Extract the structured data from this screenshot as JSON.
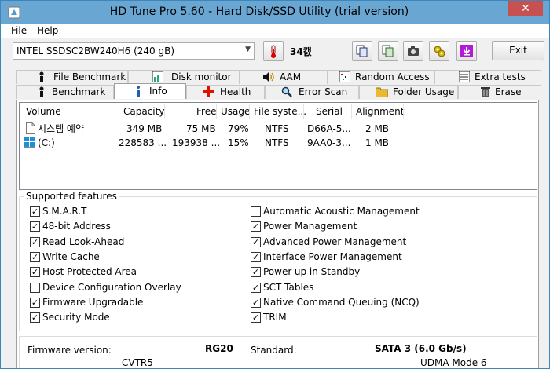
{
  "window": {
    "title": "HD Tune Pro 5.60 - Hard Disk/SSD Utility (trial version)",
    "close": "✕"
  },
  "menu": {
    "file": "File",
    "help": "Help"
  },
  "toolbar": {
    "drive": "INTEL SSDSC2BW240H6 (240 gB)",
    "temperature": "34캜",
    "exit": "Exit"
  },
  "tabs": {
    "row1": [
      "File Benchmark",
      "Disk monitor",
      "AAM",
      "Random Access",
      "Extra tests"
    ],
    "row2": [
      "Benchmark",
      "Info",
      "Health",
      "Error Scan",
      "Folder Usage",
      "Erase"
    ],
    "active": "Info"
  },
  "volumes": {
    "headers": [
      "Volume",
      "Capacity",
      "Free",
      "Usage",
      "File syste...",
      "Serial",
      "Alignment"
    ],
    "rows": [
      {
        "volume": "시스템 예약",
        "capacity": "349 MB",
        "free": "75 MB",
        "usage": "79%",
        "fs": "NTFS",
        "serial": "D66A-5...",
        "alignment": "2 MB"
      },
      {
        "volume": "(C:)",
        "capacity": "228583 ...",
        "free": "193938 ...",
        "usage": "15%",
        "fs": "NTFS",
        "serial": "9AA0-3...",
        "alignment": "1 MB"
      }
    ]
  },
  "features": {
    "title": "Supported features",
    "left": [
      {
        "label": "S.M.A.R.T",
        "checked": true
      },
      {
        "label": "48-bit Address",
        "checked": true
      },
      {
        "label": "Read Look-Ahead",
        "checked": true
      },
      {
        "label": "Write Cache",
        "checked": true
      },
      {
        "label": "Host Protected Area",
        "checked": true
      },
      {
        "label": "Device Configuration Overlay",
        "checked": false
      },
      {
        "label": "Firmware Upgradable",
        "checked": true
      },
      {
        "label": "Security Mode",
        "checked": true
      }
    ],
    "right": [
      {
        "label": "Automatic Acoustic Management",
        "checked": false
      },
      {
        "label": "Power Management",
        "checked": true
      },
      {
        "label": "Advanced Power Management",
        "checked": true
      },
      {
        "label": "Interface Power Management",
        "checked": true
      },
      {
        "label": "Power-up in Standby",
        "checked": true
      },
      {
        "label": "SCT Tables",
        "checked": true
      },
      {
        "label": "Native Command Queuing (NCQ)",
        "checked": true
      },
      {
        "label": "TRIM",
        "checked": true
      }
    ]
  },
  "info": {
    "firmware_label": "Firmware version:",
    "firmware_value": "RG20",
    "standard_label": "Standard:",
    "standard_value": "SATA 3 (6.0 Gb/s)",
    "serial_partial": "CVTR5",
    "ext_partial": "UDMA Mode 6"
  }
}
